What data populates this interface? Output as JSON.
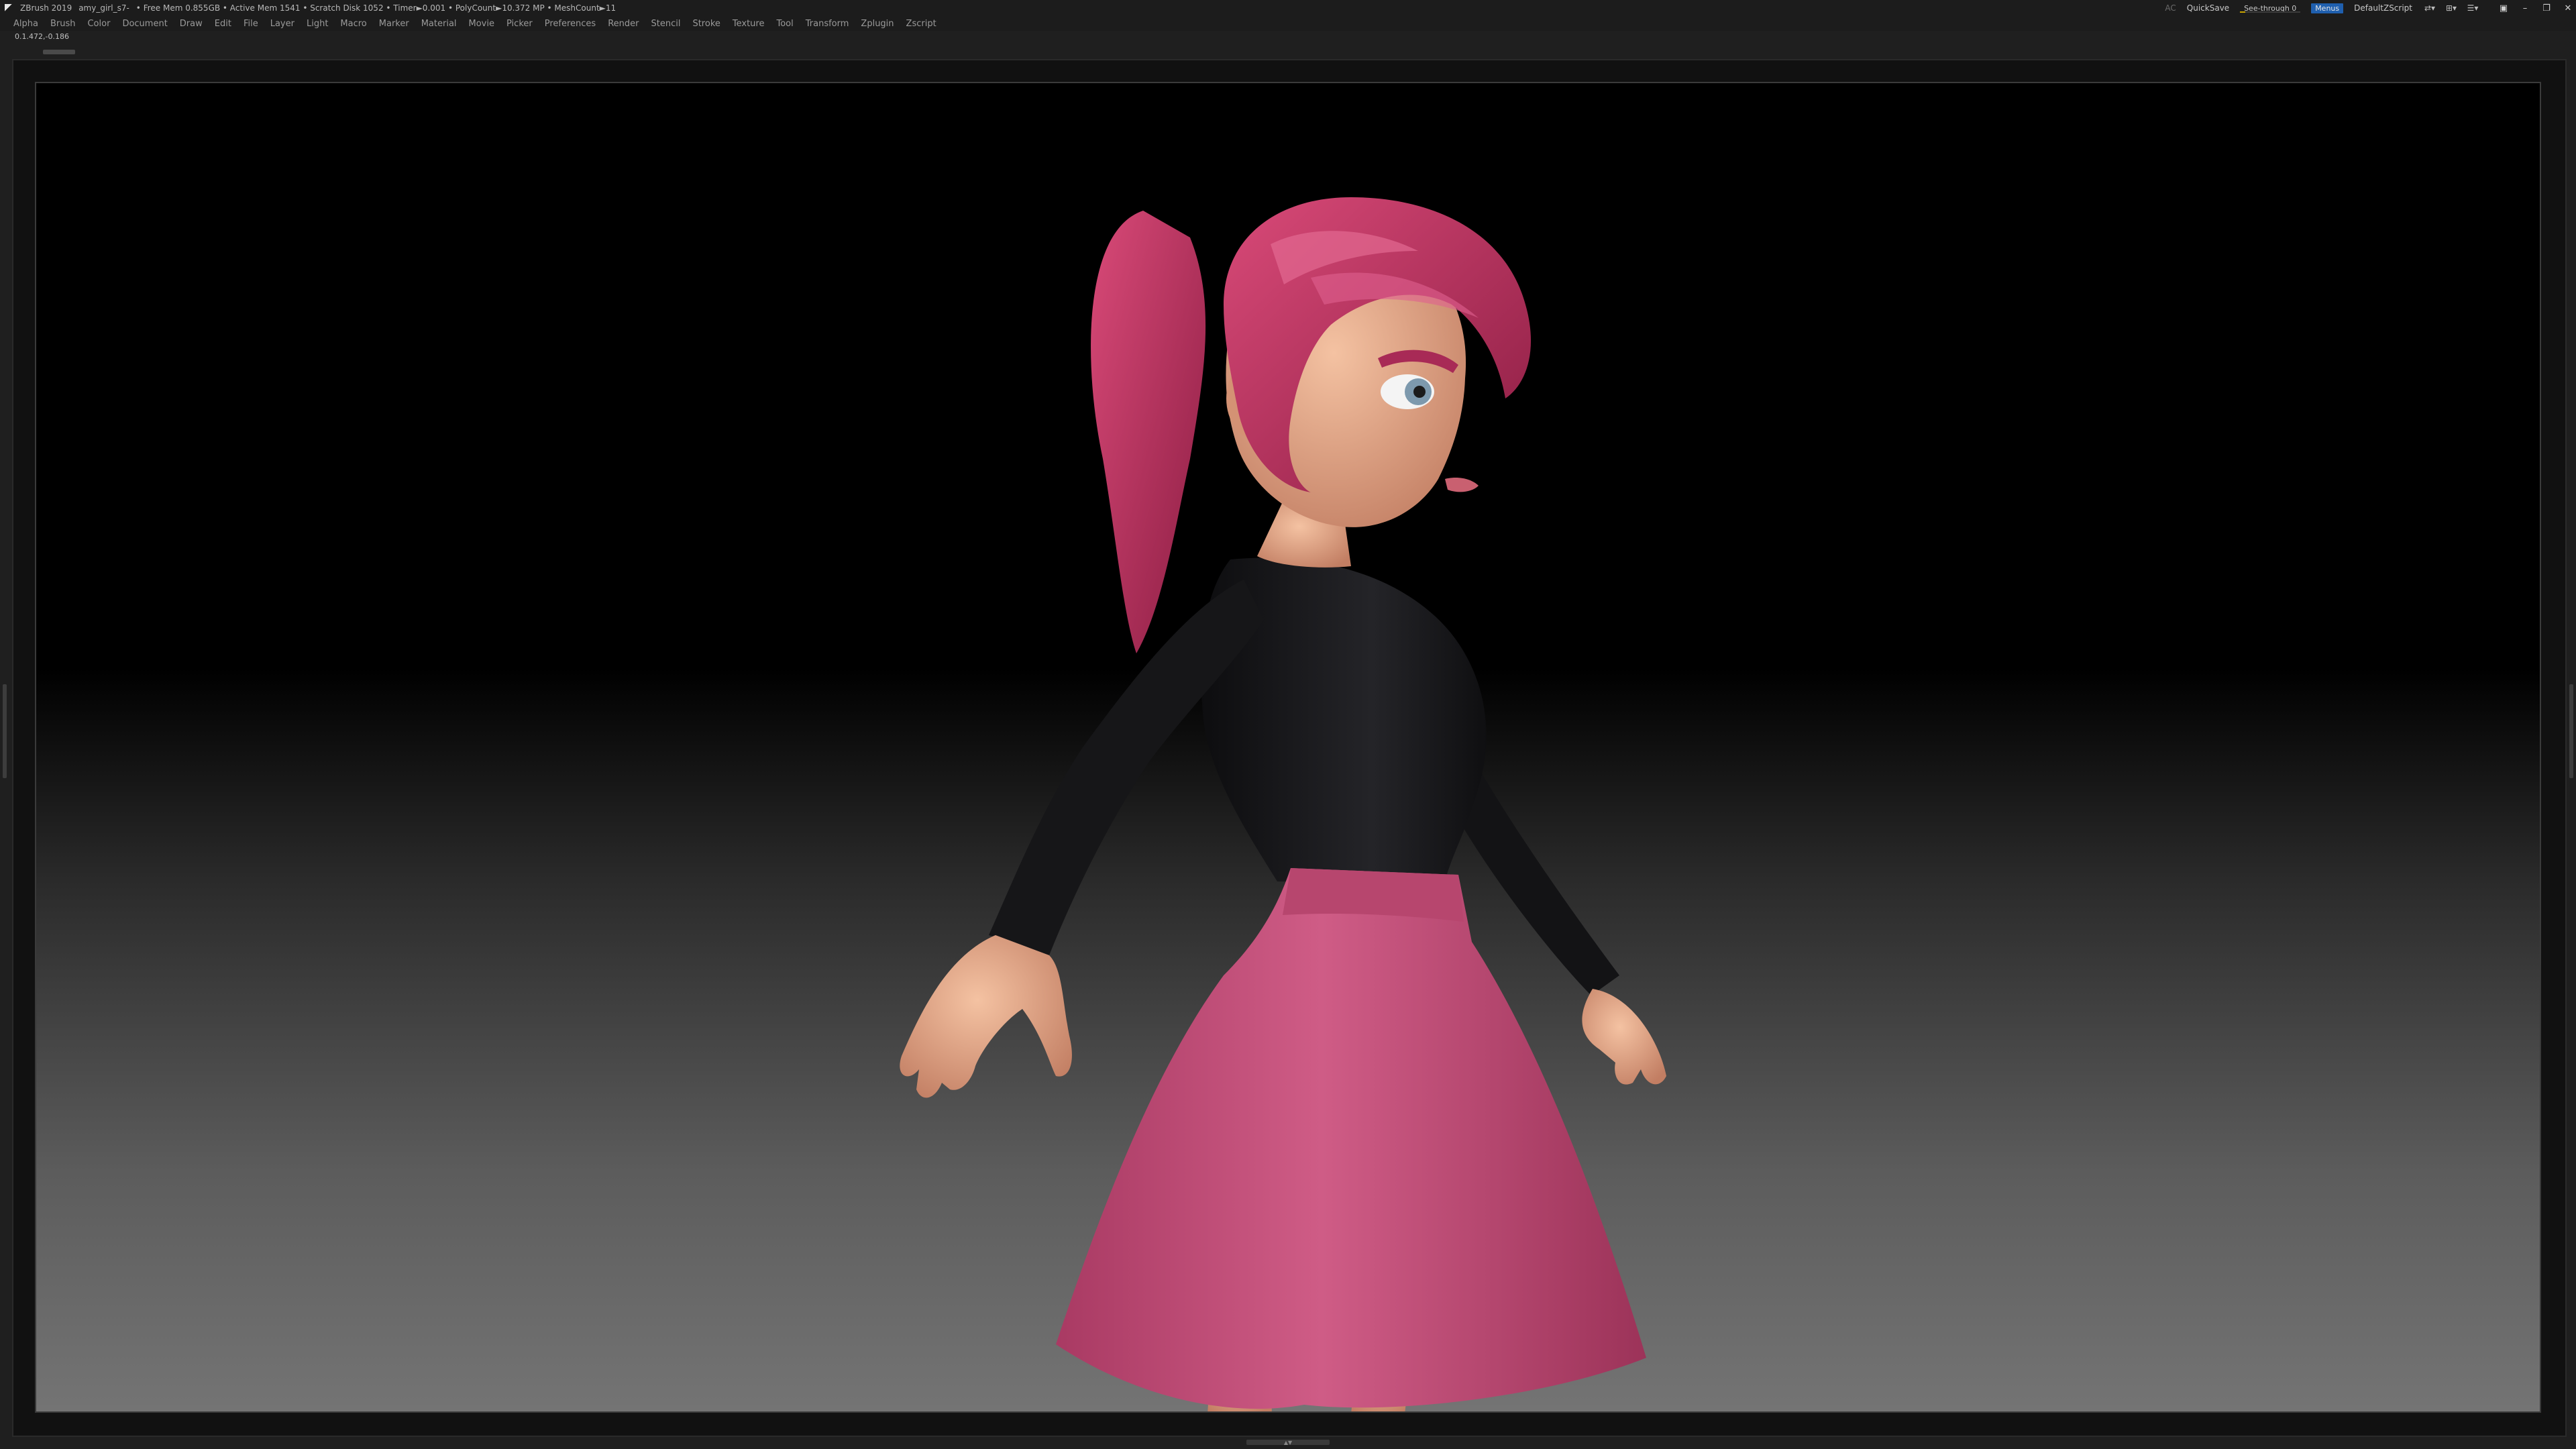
{
  "titlebar": {
    "app_name": "ZBrush 2019",
    "file_name": "amy_girl_s7-",
    "stats": "• Free Mem 0.855GB • Active Mem 1541 • Scratch Disk 1052 • Timer►0.001 • PolyCount►10.372 MP • MeshCount►11",
    "ac_label": "AC",
    "quicksave_label": "QuickSave",
    "see_through_label": "See-through  0",
    "see_through_value": 0,
    "menus_label": "Menus",
    "script_label": "DefaultZScript"
  },
  "menu": [
    "Alpha",
    "Brush",
    "Color",
    "Document",
    "Draw",
    "Edit",
    "File",
    "Layer",
    "Light",
    "Macro",
    "Marker",
    "Material",
    "Movie",
    "Picker",
    "Preferences",
    "Render",
    "Stencil",
    "Stroke",
    "Texture",
    "Tool",
    "Transform",
    "Zplugin",
    "Zscript"
  ],
  "coords": "0.1.472,-0.186",
  "colors": {
    "skin": "#e8a788",
    "hair": "#c0325e",
    "shirt": "#141416",
    "skirt": "#c04c76",
    "accent_blue": "#1f5fae"
  },
  "icons": {
    "app": "zbrush-logo-icon",
    "window": [
      "layout-icon",
      "help-icon",
      "menu-icon"
    ],
    "window_controls": [
      "minimize-icon",
      "restore-icon",
      "close-icon"
    ]
  }
}
